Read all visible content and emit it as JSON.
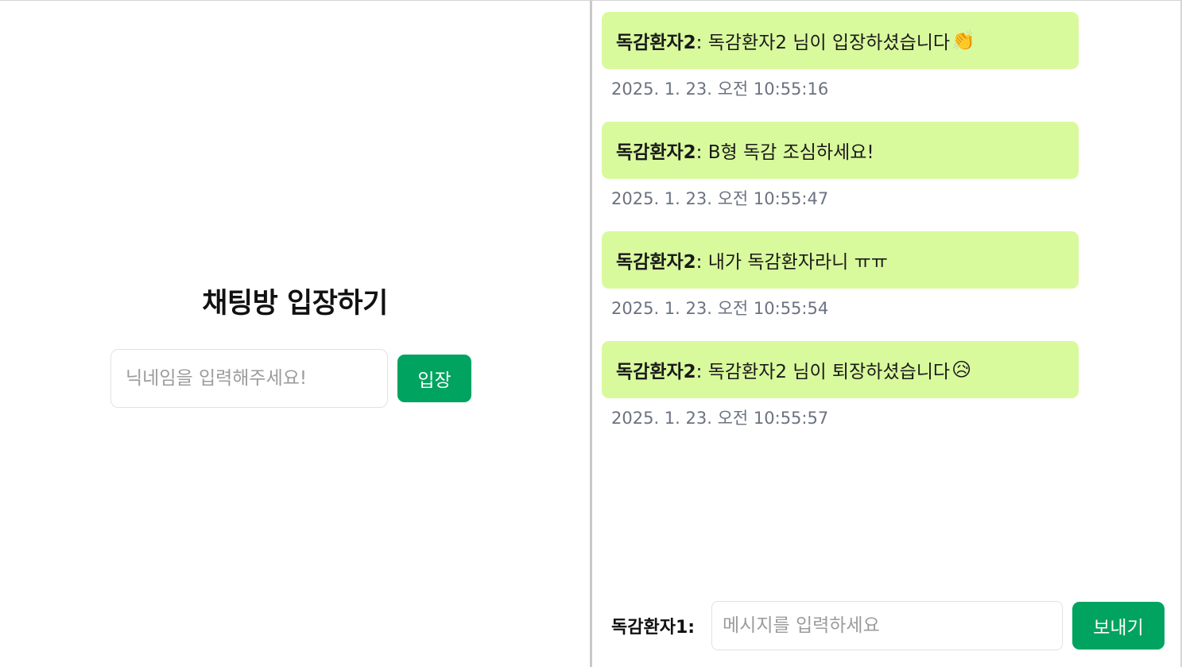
{
  "join": {
    "title": "채팅방 입장하기",
    "nickname_placeholder": "닉네임을 입력해주세요!",
    "enter_label": "입장"
  },
  "messages": [
    {
      "sender": "독감환자2",
      "text": ": 독감환자2 님이 입장하셨습니다",
      "emoji": "👏",
      "time": "2025. 1. 23. 오전 10:55:16"
    },
    {
      "sender": "독감환자2",
      "text": ": B형 독감 조심하세요!",
      "emoji": "",
      "time": "2025. 1. 23. 오전 10:55:47"
    },
    {
      "sender": "독감환자2",
      "text": ": 내가 독감환자라니 ㅠㅠ",
      "emoji": "",
      "time": "2025. 1. 23. 오전 10:55:54"
    },
    {
      "sender": "독감환자2",
      "text": ": 독감환자2 님이 퇴장하셨습니다",
      "emoji": "😥",
      "time": "2025. 1. 23. 오전 10:55:57"
    }
  ],
  "composer": {
    "user_label": "독감환자1:",
    "placeholder": "메시지를 입력하세요",
    "send_label": "보내기"
  },
  "colors": {
    "accent": "#00a35f",
    "bubble": "#d9f99d",
    "timestamp": "#6b7280"
  }
}
